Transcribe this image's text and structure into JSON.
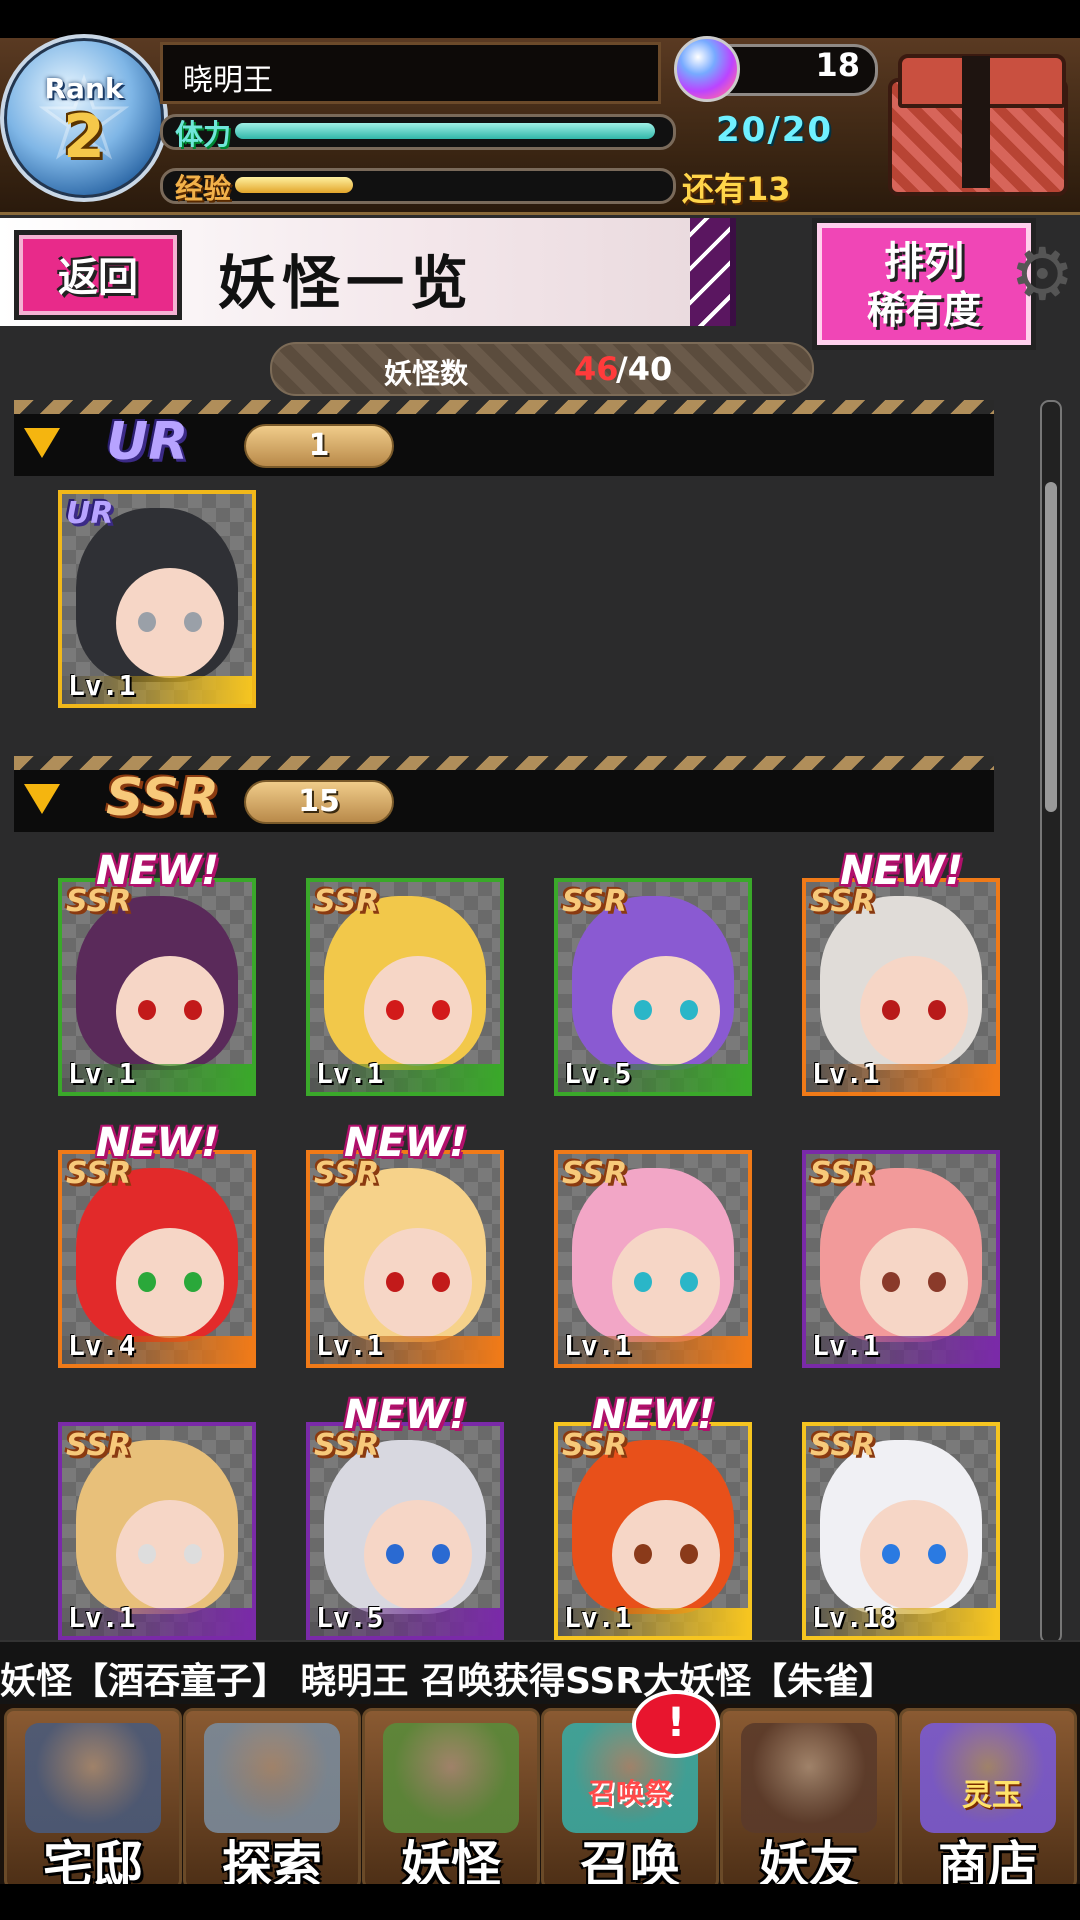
{
  "header": {
    "rank_label": "Rank",
    "rank_value": "2",
    "player_name": "晓明王",
    "hp_label": "体力",
    "hp_value": "20/20",
    "exp_label": "经验",
    "exp_progress_percent": 28,
    "exp_remaining": "还有13",
    "gem_count": "18",
    "chest_icon": "treasure-chest-icon",
    "gem_icon": "spirit-orb-icon"
  },
  "titlebar": {
    "back_label": "返回",
    "title": "妖怪一览",
    "sort_label_1": "排列",
    "sort_label_2": "稀有度"
  },
  "count": {
    "label": "妖怪数",
    "current": "46",
    "rest": "/40"
  },
  "sections": [
    {
      "rarity": "UR",
      "count": "1",
      "cards": [
        {
          "rarity": "UR",
          "level": "Lv.1",
          "new": false,
          "frame": "#f1b81a",
          "hair": "#2f3035",
          "eyes": "#9aa0a8",
          "bottom": "#f6c520"
        }
      ]
    },
    {
      "rarity": "SSR",
      "count": "15",
      "cards": [
        {
          "rarity": "SSR",
          "level": "Lv.1",
          "new": true,
          "new_label": "NEW!",
          "frame": "#3aa82a",
          "hair": "#5a2a5a",
          "eyes": "#c21a1a",
          "bottom": "#3aa82a"
        },
        {
          "rarity": "SSR",
          "level": "Lv.1",
          "new": false,
          "frame": "#3aa82a",
          "hair": "#f2c84a",
          "eyes": "#d21a1a",
          "bottom": "#3aa82a"
        },
        {
          "rarity": "SSR",
          "level": "Lv.5",
          "new": false,
          "frame": "#3aa82a",
          "hair": "#8a5ad2",
          "eyes": "#2ab6c8",
          "bottom": "#3aa82a"
        },
        {
          "rarity": "SSR",
          "level": "Lv.1",
          "new": true,
          "new_label": "NEW!",
          "frame": "#f07a18",
          "hair": "#e0dcd8",
          "eyes": "#b81a1a",
          "bottom": "#f07a18"
        },
        {
          "rarity": "SSR",
          "level": "Lv.4",
          "new": true,
          "new_label": "NEW!",
          "frame": "#f07a18",
          "hair": "#e22a2a",
          "eyes": "#2aa83a",
          "bottom": "#f07a18"
        },
        {
          "rarity": "SSR",
          "level": "Lv.1",
          "new": true,
          "new_label": "NEW!",
          "frame": "#f07a18",
          "hair": "#f6d28a",
          "eyes": "#c21a1a",
          "bottom": "#f07a18"
        },
        {
          "rarity": "SSR",
          "level": "Lv.1",
          "new": false,
          "frame": "#f07a18",
          "hair": "#f2a6c6",
          "eyes": "#2ab6c8",
          "bottom": "#f07a18"
        },
        {
          "rarity": "SSR",
          "level": "Lv.1",
          "new": false,
          "frame": "#7a2aa8",
          "hair": "#f29a9a",
          "eyes": "#8a3a2a",
          "bottom": "#7a2aa8"
        },
        {
          "rarity": "SSR",
          "level": "Lv.1",
          "new": false,
          "frame": "#7a2aa8",
          "hair": "#e8c07a",
          "eyes": "#dddddd",
          "bottom": "#7a2aa8"
        },
        {
          "rarity": "SSR",
          "level": "Lv.5",
          "new": true,
          "new_label": "NEW!",
          "frame": "#7a2aa8",
          "hair": "#d8d8e0",
          "eyes": "#2a6ad2",
          "bottom": "#7a2aa8"
        },
        {
          "rarity": "SSR",
          "level": "Lv.1",
          "new": true,
          "new_label": "NEW!",
          "frame": "#f6c520",
          "hair": "#e8501a",
          "eyes": "#8a3a1a",
          "bottom": "#f6c520"
        },
        {
          "rarity": "SSR",
          "level": "Lv.18",
          "new": false,
          "frame": "#f6c520",
          "hair": "#f0f0f4",
          "eyes": "#2a7ae2",
          "bottom": "#f6c520"
        }
      ]
    }
  ],
  "ticker": "妖怪【酒吞童子】   晓明王 召唤获得SSR大妖怪【朱雀】",
  "nav": {
    "items": [
      {
        "label": "宅邸",
        "icon": "mansion-icon",
        "art": "#4a5a7a"
      },
      {
        "label": "探索",
        "icon": "magnifier-map-icon",
        "art": "#7a8a9a"
      },
      {
        "label": "妖怪",
        "icon": "scroll-icon",
        "art": "#5a8a3a"
      },
      {
        "label": "召唤",
        "icon": "summon-star-icon",
        "art": "#3aa8a0"
      },
      {
        "label": "妖友",
        "icon": "fox-girl-icon",
        "art": "#5a3a2a"
      },
      {
        "label": "商店",
        "icon": "spirit-orb-shop-icon",
        "art": "#7a5ad2"
      }
    ],
    "summon_alert": "!",
    "summon_fest": "召唤祭",
    "shop_badge": "灵玉"
  }
}
